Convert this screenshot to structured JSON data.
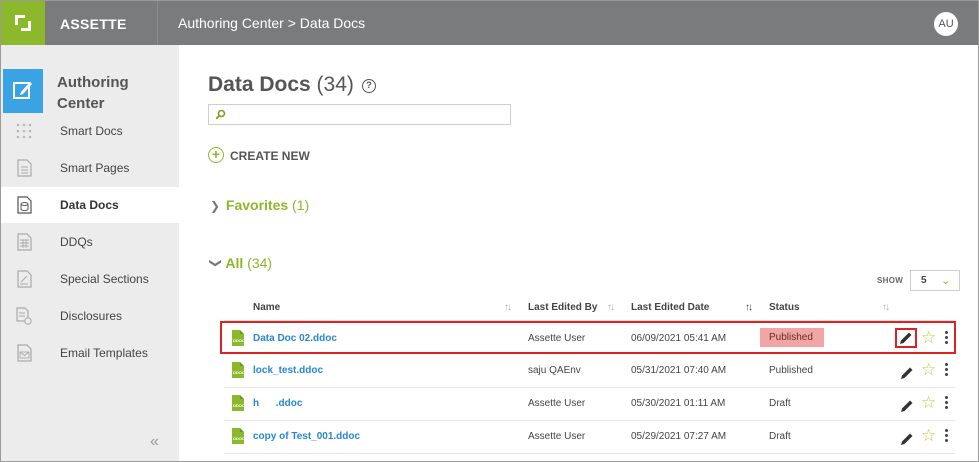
{
  "topbar": {
    "brand": "ASSETTE",
    "breadcrumb": "Authoring Center > Data Docs",
    "avatar": "AU"
  },
  "sidebar": {
    "header": "Authoring Center",
    "items": [
      {
        "label": "Smart Docs",
        "icon": "grid-dots-icon"
      },
      {
        "label": "Smart Pages",
        "icon": "page-icon"
      },
      {
        "label": "Data Docs",
        "icon": "database-doc-icon",
        "active": true
      },
      {
        "label": "DDQs",
        "icon": "ddq-table-icon"
      },
      {
        "label": "Special Sections",
        "icon": "section-icon"
      },
      {
        "label": "Disclosures",
        "icon": "disclosure-icon"
      },
      {
        "label": "Email Templates",
        "icon": "email-template-icon"
      }
    ],
    "collapse": "«"
  },
  "main": {
    "title": "Data Docs",
    "count": "(34)",
    "help": "?",
    "search_placeholder": "",
    "create_new": "CREATE NEW",
    "favorites": {
      "label": "Favorites",
      "count": "(1)"
    },
    "all": {
      "label": "All",
      "count": "(34)"
    },
    "show": {
      "label": "SHOW",
      "value": "5"
    },
    "columns": {
      "name": "Name",
      "last_edited_by": "Last Edited By",
      "last_edited_date": "Last Edited Date",
      "status": "Status"
    },
    "rows": [
      {
        "name": "Data Doc 02.ddoc",
        "by": "Assette User",
        "date": "06/09/2021 05:41 AM",
        "status": "Published",
        "highlight": true
      },
      {
        "name": "lock_test.ddoc",
        "by": "saju QAEnv",
        "date": "05/31/2021 07:40 AM",
        "status": "Published"
      },
      {
        "name": "h      .ddoc",
        "by": "Assette User",
        "date": "05/30/2021 01:11 AM",
        "status": "Draft"
      },
      {
        "name": "copy of Test_001.ddoc",
        "by": "Assette User",
        "date": "05/29/2021 07:27 AM",
        "status": "Draft"
      }
    ],
    "file_icon_text": "DDOC"
  },
  "colors": {
    "brand_green": "#8cb82b",
    "topbar": "#7a7b7c",
    "accent_blue": "#3aa3e3",
    "link_blue": "#2a86d1",
    "published_badge": "#f1a5a5",
    "highlight_red": "#dd2222"
  }
}
